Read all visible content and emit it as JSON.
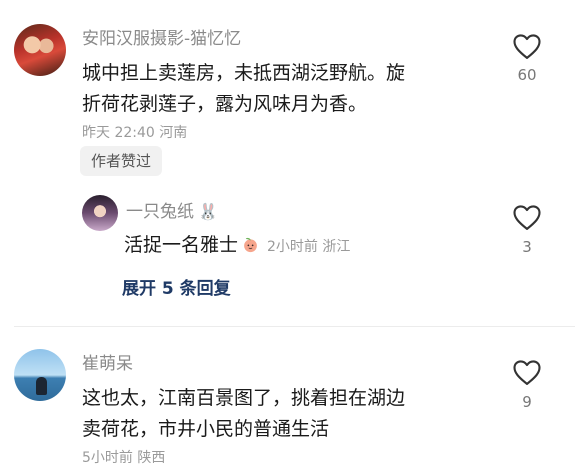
{
  "comments": [
    {
      "author": "安阳汉服摄影-猫忆忆",
      "text_line1": "城中担上卖莲房，未抵西湖泛野航。旋",
      "text_line2": "折荷花剥莲子，露为风味月为香。",
      "meta": "昨天 22:40 河南",
      "badge": "作者赞过",
      "likes": "60"
    },
    {
      "author": "一只兔纸",
      "author_suffix": "🐰",
      "text": "活捉一名雅士",
      "meta": "2小时前 浙江",
      "likes": "3",
      "expand_label": "展开 5 条回复"
    },
    {
      "author": "崔萌呆",
      "text_line1": "这也太，江南百景图了，挑着担在湖边",
      "text_line2": "卖荷花，市井小民的普通生活",
      "meta": "5小时前 陕西",
      "likes": "9"
    }
  ],
  "icons": {
    "like": "heart-outline-icon",
    "emoji": "peach-emoji-icon"
  }
}
